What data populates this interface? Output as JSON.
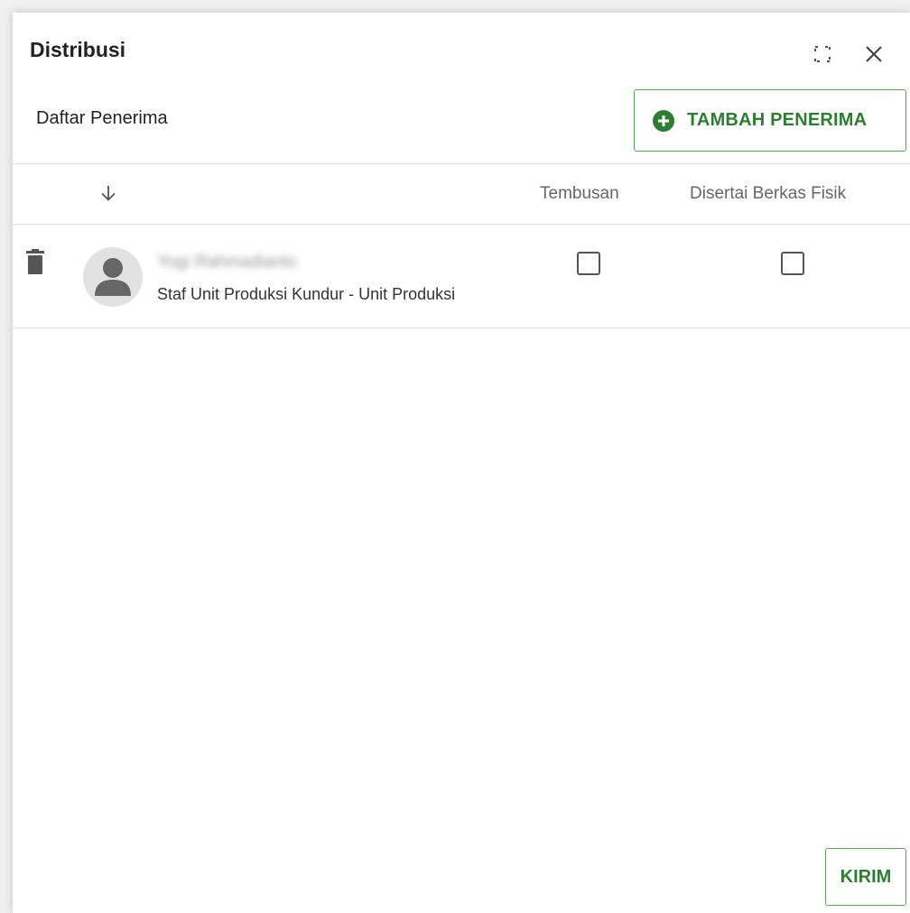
{
  "dialog": {
    "title": "Distribusi",
    "fullscreen_icon": "fullscreen-icon",
    "close_icon": "close-icon"
  },
  "recipients": {
    "section_label": "Daftar Penerima",
    "add_button_label": "TAMBAH PENERIMA",
    "add_icon": "plus-circle-icon",
    "accent_color": "#2e7d32"
  },
  "table": {
    "sort_icon": "arrow-down-icon",
    "columns": {
      "tembusan": "Tembusan",
      "berkas_fisik": "Disertai Berkas Fisik"
    },
    "rows": [
      {
        "name": "Yogi Rahmadianto",
        "position": "Staf Unit Produksi Kundur - Unit Produksi",
        "tembusan": false,
        "berkas_fisik": false
      }
    ]
  },
  "footer": {
    "send_label": "KIRIM"
  }
}
